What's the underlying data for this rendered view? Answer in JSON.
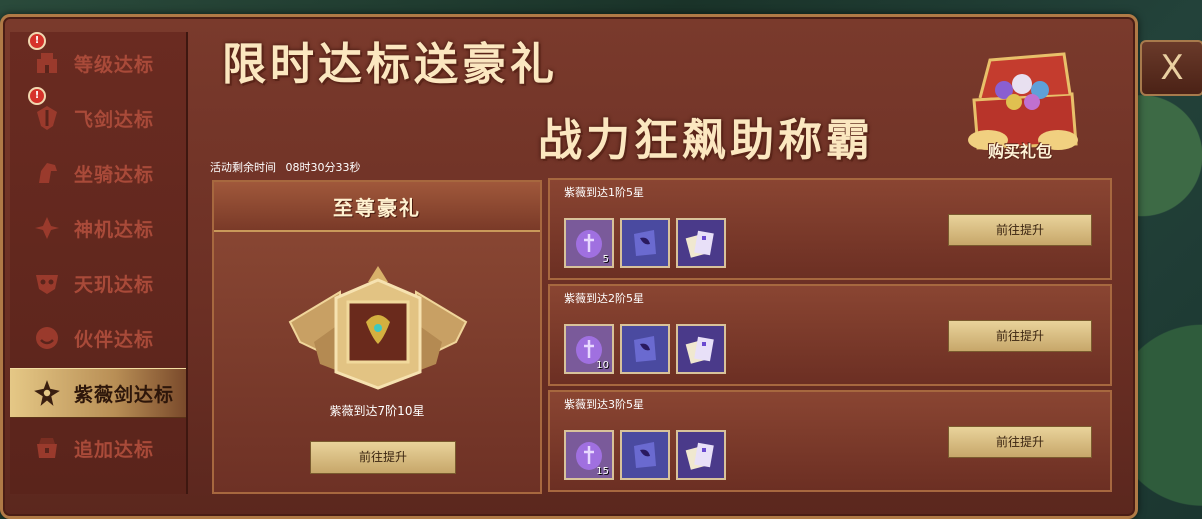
{
  "sidebar": {
    "items": [
      {
        "label": "等级达标",
        "icon": "building-icon",
        "alert": true,
        "active": false
      },
      {
        "label": "飞剑达标",
        "icon": "sword-crest-icon",
        "alert": true,
        "active": false
      },
      {
        "label": "坐骑达标",
        "icon": "horse-icon",
        "alert": false,
        "active": false
      },
      {
        "label": "神机达标",
        "icon": "machine-icon",
        "alert": false,
        "active": false
      },
      {
        "label": "天玑达标",
        "icon": "mask-icon",
        "alert": false,
        "active": false
      },
      {
        "label": "伙伴达标",
        "icon": "companion-icon",
        "alert": false,
        "active": false
      },
      {
        "label": "紫薇剑达标",
        "icon": "ziwei-sword-icon",
        "alert": false,
        "active": true
      },
      {
        "label": "追加达标",
        "icon": "chest-icon",
        "alert": false,
        "active": false
      }
    ],
    "alert_glyph": "!"
  },
  "banner": {
    "title_line1": "限时达标送豪礼",
    "title_line2": "战力狂飙助称霸",
    "buy_label": "购买礼包"
  },
  "close_label": "X",
  "timer": {
    "label": "活动剩余时间",
    "value": "08时30分33秒"
  },
  "grand_prize": {
    "heading": "至尊豪礼",
    "requirement": "紫薇到达7阶10星",
    "button_label": "前往提升"
  },
  "tasks": [
    {
      "title": "紫薇到达1阶5星",
      "button_label": "前往提升",
      "items": [
        {
          "icon": "purple-gem-icon",
          "qty": "5"
        },
        {
          "icon": "purple-book-icon",
          "qty": ""
        },
        {
          "icon": "scroll-cards-icon",
          "qty": ""
        }
      ]
    },
    {
      "title": "紫薇到达2阶5星",
      "button_label": "前往提升",
      "items": [
        {
          "icon": "purple-gem-icon",
          "qty": "10"
        },
        {
          "icon": "purple-book-icon",
          "qty": ""
        },
        {
          "icon": "scroll-cards-icon",
          "qty": ""
        }
      ]
    },
    {
      "title": "紫薇到达3阶5星",
      "button_label": "前往提升",
      "items": [
        {
          "icon": "purple-gem-icon",
          "qty": "15"
        },
        {
          "icon": "purple-book-icon",
          "qty": ""
        },
        {
          "icon": "scroll-cards-icon",
          "qty": ""
        }
      ]
    }
  ],
  "colors": {
    "panel": "#6b2f24",
    "gold": "#e9d39b",
    "accent_text": "#fbe7c0"
  }
}
